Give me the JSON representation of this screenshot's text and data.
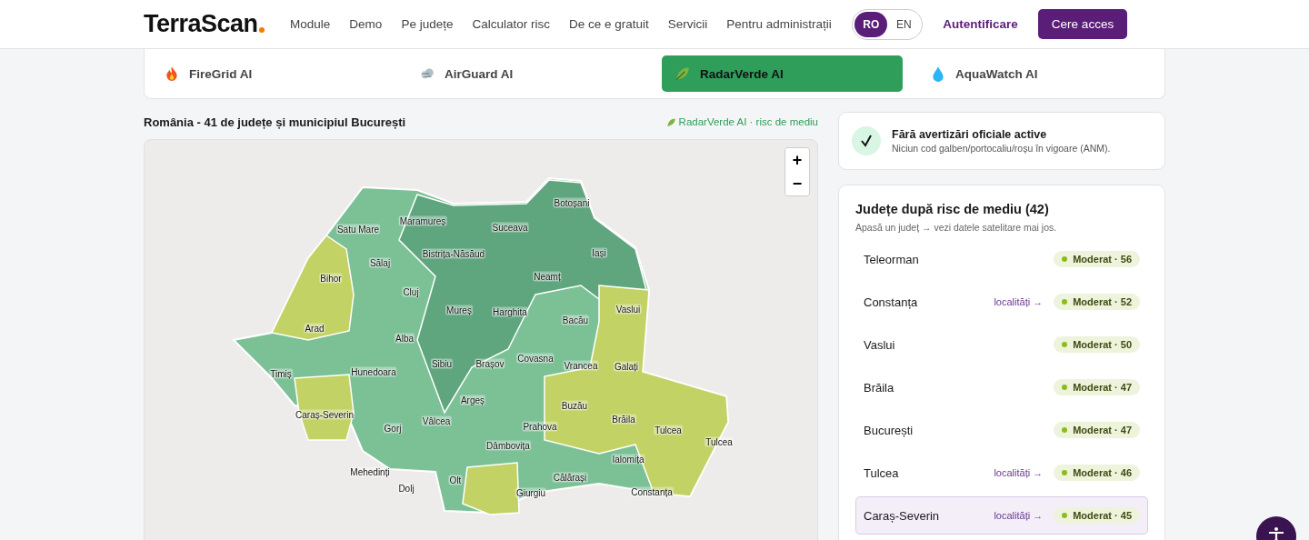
{
  "header": {
    "logo": "TerraScan",
    "nav": [
      "Module",
      "Demo",
      "Pe județe",
      "Calculator risc",
      "De ce e gratuit",
      "Servicii",
      "Pentru administrații"
    ],
    "languages": [
      {
        "label": "RO",
        "selected": true
      },
      {
        "label": "EN",
        "selected": false
      }
    ],
    "login": "Autentificare",
    "cta": "Cere acces"
  },
  "tabs": [
    {
      "label": "FireGrid AI",
      "kind": "fire",
      "selected": false
    },
    {
      "label": "AirGuard AI",
      "kind": "wind",
      "selected": false
    },
    {
      "label": "RadarVerde AI",
      "kind": "leaf",
      "selected": true
    },
    {
      "label": "AquaWatch AI",
      "kind": "drop",
      "selected": false
    }
  ],
  "map": {
    "title": "România - 41 de județe și municipiul București",
    "source": "RadarVerde AI · risc de mediu",
    "zoom_in": "+",
    "zoom_out": "−",
    "counties": [
      "Botoșani",
      "Maramureș",
      "Satu Mare",
      "Suceava",
      "Bistrița-Năsăud",
      "Iași",
      "Sălaj",
      "Neamț",
      "Bihor",
      "Cluj",
      "Mureș",
      "Harghita",
      "Vaslui",
      "Bacău",
      "Arad",
      "Alba",
      "Sibiu",
      "Brașov",
      "Covasna",
      "Vrancea",
      "Galați",
      "Timiș",
      "Hunedoara",
      "Argeș",
      "Buzău",
      "Caraș-Severin",
      "Gorj",
      "Vâlcea",
      "Prahova",
      "Brăila",
      "Tulcea",
      "Tulcea",
      "Dâmbovița",
      "Ialomița",
      "Mehedinți",
      "Călărași",
      "Olt",
      "Dolj",
      "Giurgiu",
      "Constanța"
    ]
  },
  "alert": {
    "title": "Fără avertizări oficiale active",
    "text": "Niciun cod galben/portocaliu/roșu în vigoare (ANM)."
  },
  "ranking": {
    "title": "Județe după risc de mediu (42)",
    "hint": "Apasă un județ → vezi datele satelitare mai jos.",
    "rows": [
      {
        "name": "Teleorman",
        "badge": "Moderat · 56",
        "selected": false
      },
      {
        "name": "Constanța",
        "link": "localități →",
        "badge": "Moderat · 52",
        "selected": false
      },
      {
        "name": "Vaslui",
        "badge": "Moderat · 50",
        "selected": false
      },
      {
        "name": "Brăila",
        "badge": "Moderat · 47",
        "selected": false
      },
      {
        "name": "București",
        "badge": "Moderat · 47",
        "selected": false
      },
      {
        "name": "Tulcea",
        "link": "localități →",
        "badge": "Moderat · 46",
        "selected": false
      },
      {
        "name": "Caraș-Severin",
        "link": "localități →",
        "badge": "Moderat · 45",
        "selected": true
      }
    ]
  }
}
